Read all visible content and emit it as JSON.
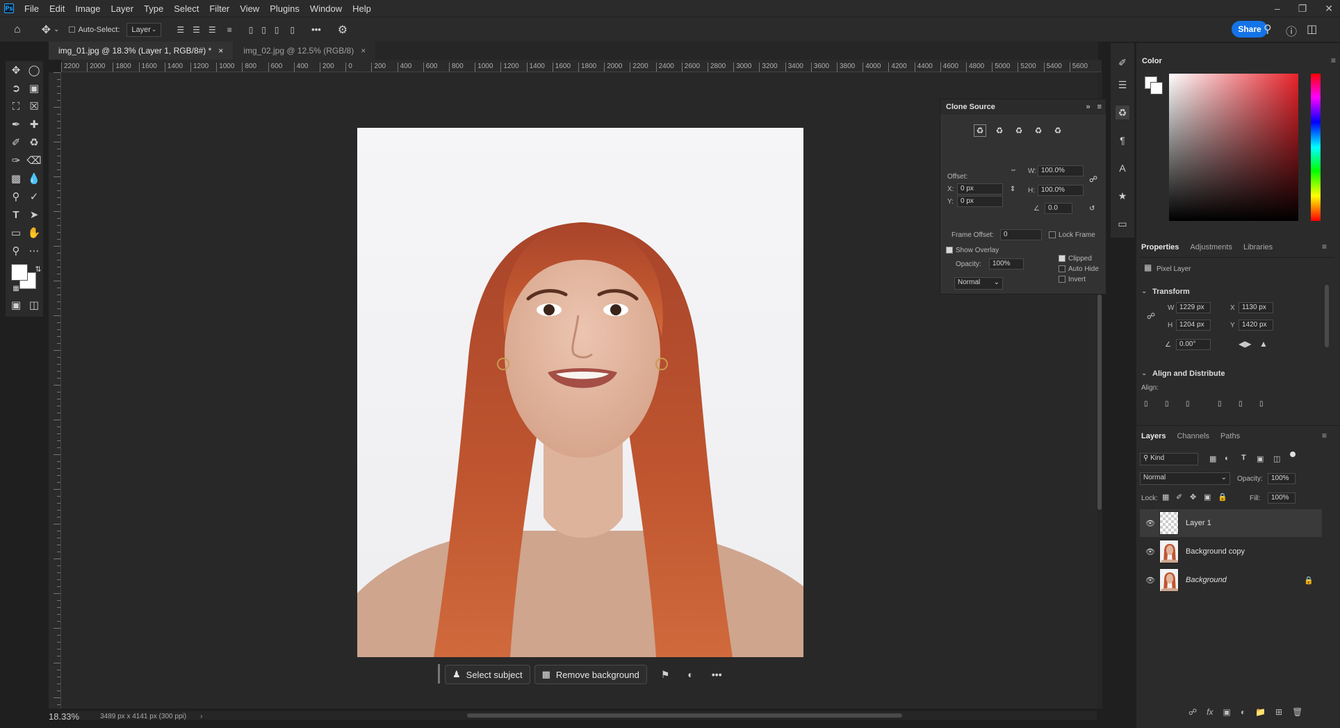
{
  "app": {
    "logo": "Ps"
  },
  "menu": [
    "File",
    "Edit",
    "Image",
    "Layer",
    "Type",
    "Select",
    "Filter",
    "View",
    "Plugins",
    "Window",
    "Help"
  ],
  "options_bar": {
    "auto_select_label": "Auto-Select:",
    "auto_select_target": "Layer",
    "more": "•••",
    "share_label": "Share"
  },
  "tabs": [
    {
      "label": "img_01.jpg @ 18.3% (Layer 1, RGB/8#) *",
      "active": true
    },
    {
      "label": "img_02.jpg @ 12.5% (RGB/8)",
      "active": false
    }
  ],
  "ruler": {
    "h_ticks": [
      "2200",
      "2000",
      "1800",
      "1600",
      "1400",
      "1200",
      "1000",
      "800",
      "600",
      "400",
      "200",
      "0",
      "200",
      "400",
      "600",
      "800",
      "1000",
      "1200",
      "1400",
      "1600",
      "1800",
      "2000",
      "2200",
      "2400",
      "2600",
      "2800",
      "3000",
      "3200",
      "3400",
      "3600",
      "3800",
      "4000",
      "4200",
      "4400",
      "4600",
      "4800",
      "5000",
      "5200",
      "5400",
      "5600"
    ]
  },
  "status": {
    "zoom": "18.33%",
    "doc_info": "3489 px x 4141 px (300 ppi)"
  },
  "contextual_taskbar": {
    "select_subject": "Select subject",
    "remove_background": "Remove background",
    "more": "•••"
  },
  "clone_source": {
    "title": "Clone Source",
    "offset_label": "Offset:",
    "x_label": "X:",
    "x_value": "0 px",
    "y_label": "Y:",
    "y_value": "0 px",
    "w_label": "W:",
    "w_value": "100.0%",
    "h_label": "H:",
    "h_value": "100.0%",
    "angle_value": "0.0",
    "frame_offset_label": "Frame Offset:",
    "frame_offset_value": "0",
    "lock_frame_label": "Lock Frame",
    "show_overlay_label": "Show Overlay",
    "opacity_label": "Opacity:",
    "opacity_value": "100%",
    "blend_mode": "Normal",
    "clipped_label": "Clipped",
    "auto_hide_label": "Auto Hide",
    "invert_label": "Invert"
  },
  "color_panel": {
    "title": "Color",
    "hue_color": "#e8232b"
  },
  "properties": {
    "tabs": [
      "Properties",
      "Adjustments",
      "Libraries"
    ],
    "layer_type": "Pixel Layer",
    "transform_label": "Transform",
    "w_label": "W",
    "w_value": "1229 px",
    "h_label": "H",
    "h_value": "1204 px",
    "x_label": "X",
    "x_value": "1130 px",
    "y_label": "Y",
    "y_value": "1420 px",
    "angle_value": "0.00°",
    "align_label": "Align and Distribute",
    "align_sub": "Align:"
  },
  "layers_panel": {
    "tabs": [
      "Layers",
      "Channels",
      "Paths"
    ],
    "filter_kind": "Kind",
    "blend_mode": "Normal",
    "opacity_label": "Opacity:",
    "opacity_value": "100%",
    "lock_label": "Lock:",
    "fill_label": "Fill:",
    "fill_value": "100%",
    "layers": [
      {
        "name": "Layer 1",
        "selected": true
      },
      {
        "name": "Background copy",
        "selected": false
      },
      {
        "name": "Background",
        "selected": false,
        "locked": true
      }
    ]
  }
}
